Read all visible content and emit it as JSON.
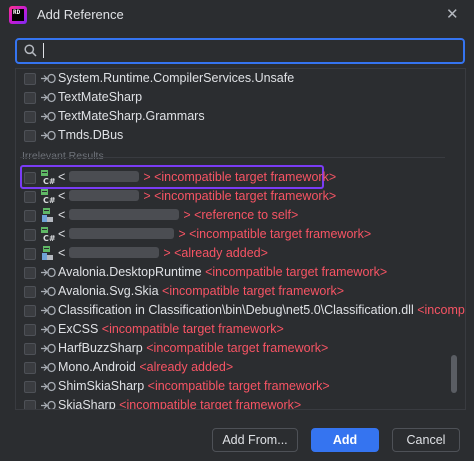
{
  "window": {
    "title": "Add Reference",
    "close_icon": "close-icon",
    "app_icon_text": "RD"
  },
  "search": {
    "value": "",
    "icon": "search-icon"
  },
  "section_label": "Irrelevant Results",
  "list_rows": [
    {
      "name": "System.Runtime.CompilerServices.Unsafe",
      "status": ""
    },
    {
      "name": "TextMateSharp",
      "status": ""
    },
    {
      "name": "TextMateSharp.Grammars",
      "status": ""
    },
    {
      "name": "Tmds.DBus",
      "status": ""
    },
    {
      "name": "<",
      "status": "> <incompatible target framework>",
      "highlighted": true
    },
    {
      "name": "<",
      "status": "> <incompatible target framework>"
    },
    {
      "name": "<",
      "status": "> <reference to self>"
    },
    {
      "name": "<",
      "status": "> <incompatible target framework>"
    },
    {
      "name": "<",
      "status": "> <already added>"
    },
    {
      "name": "Avalonia.DesktopRuntime",
      "status": "<incompatible target framework>"
    },
    {
      "name": "Avalonia.Svg.Skia",
      "status": "<incompatible target framework>"
    },
    {
      "name": "Classification  in Classification\\bin\\Debug\\net5.0\\Classification.dll",
      "status": "<incompat"
    },
    {
      "name": "ExCSS",
      "status": "<incompatible target framework>"
    },
    {
      "name": "HarfBuzzSharp",
      "status": "<incompatible target framework>"
    },
    {
      "name": "Mono.Android",
      "status": "<already added>"
    },
    {
      "name": "ShimSkiaSharp",
      "status": "<incompatible target framework>"
    },
    {
      "name": "SkiaSharp",
      "status": "<incompatible target framework>"
    }
  ],
  "buttons": {
    "add_from": "Add From...",
    "add": "Add",
    "cancel": "Cancel"
  },
  "colors": {
    "accent": "#3574f0",
    "error": "#f75464",
    "highlight": "#7a3cf5"
  }
}
